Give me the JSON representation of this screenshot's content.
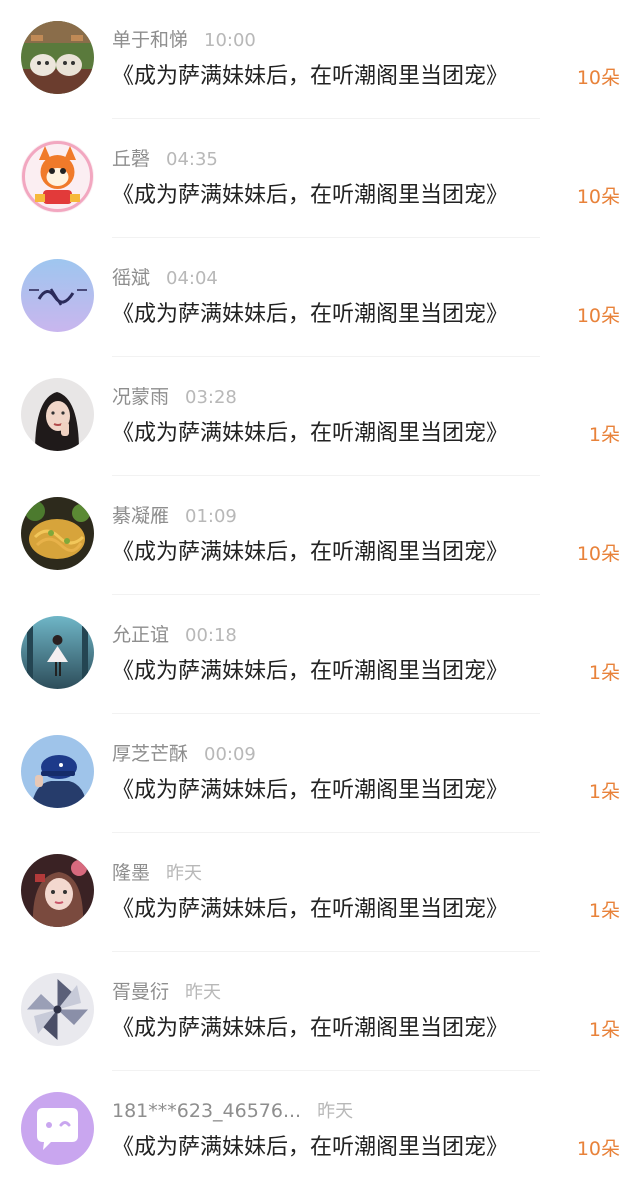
{
  "gift_list": [
    {
      "name": "单于和悌",
      "time": "10:00",
      "title": "《成为萨满妹妹后，在听潮阁里当团宠》",
      "gift": "10朵",
      "avatar_icon": "avatar-cat-figurines"
    },
    {
      "name": "丘磬",
      "time": "04:35",
      "title": "《成为萨满妹妹后，在听潮阁里当团宠》",
      "gift": "10朵",
      "avatar_icon": "avatar-cartoon-fox"
    },
    {
      "name": "徭斌",
      "time": "04:04",
      "title": "《成为萨满妹妹后，在听潮阁里当团宠》",
      "gift": "10朵",
      "avatar_icon": "avatar-calligraphy"
    },
    {
      "name": "况蒙雨",
      "time": "03:28",
      "title": "《成为萨满妹妹后，在听潮阁里当团宠》",
      "gift": "1朵",
      "avatar_icon": "avatar-portrait"
    },
    {
      "name": "綦凝雁",
      "time": "01:09",
      "title": "《成为萨满妹妹后，在听潮阁里当团宠》",
      "gift": "10朵",
      "avatar_icon": "avatar-food"
    },
    {
      "name": "允正谊",
      "time": "00:18",
      "title": "《成为萨满妹妹后，在听潮阁里当团宠》",
      "gift": "1朵",
      "avatar_icon": "avatar-figure-stage"
    },
    {
      "name": "厚芝芒酥",
      "time": "00:09",
      "title": "《成为萨满妹妹后，在听潮阁里当团宠》",
      "gift": "1朵",
      "avatar_icon": "avatar-blue-cap"
    },
    {
      "name": "隆墨",
      "time": "昨天",
      "title": "《成为萨满妹妹后，在听潮阁里当团宠》",
      "gift": "1朵",
      "avatar_icon": "avatar-girl"
    },
    {
      "name": "胥曼衍",
      "time": "昨天",
      "title": "《成为萨满妹妹后，在听潮阁里当团宠》",
      "gift": "1朵",
      "avatar_icon": "avatar-pinwheel"
    },
    {
      "name": "181***623_46576...",
      "time": "昨天",
      "title": "《成为萨满妹妹后，在听潮阁里当团宠》",
      "gift": "10朵",
      "avatar_icon": "avatar-default-chat"
    }
  ],
  "colors": {
    "name": "#8e8e8e",
    "time": "#b8b8b8",
    "title": "#222222",
    "gift": "#e8823a",
    "default_avatar": "#c9a6ef"
  }
}
